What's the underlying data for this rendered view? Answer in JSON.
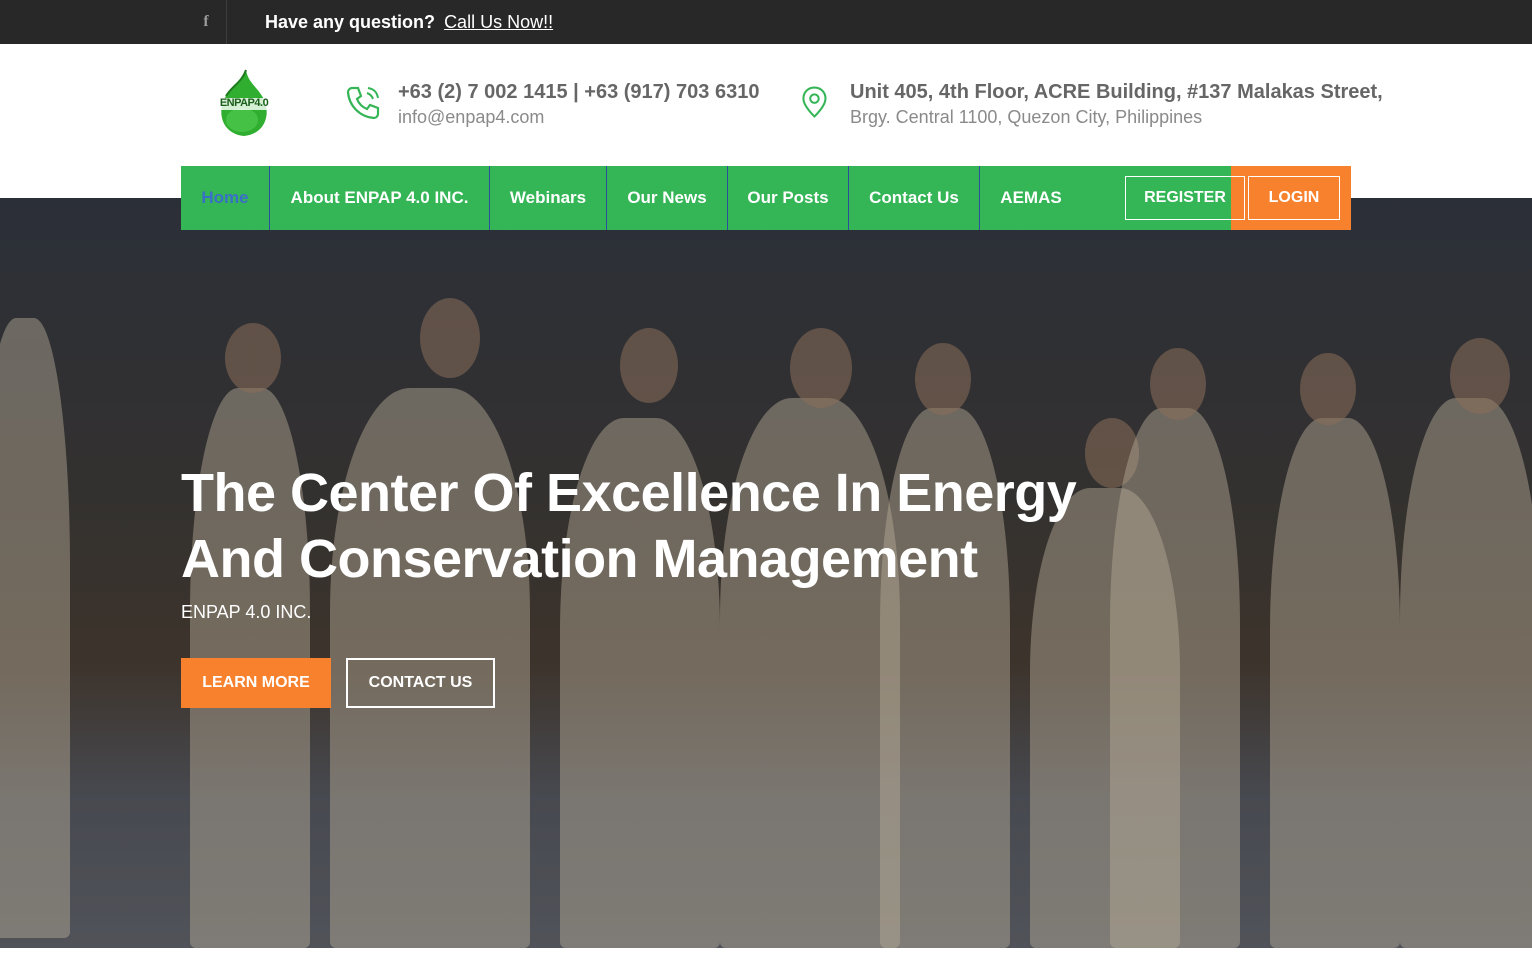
{
  "topbar": {
    "facebook_icon": "facebook-icon",
    "question": "Have any question?",
    "call_link": "Call Us Now!!"
  },
  "header": {
    "logo_text": "ENPAP4.0",
    "phone": "+63 (2) 7 002 1415 | +63 (917) 703 6310",
    "email": "info@enpap4.com",
    "address_line1": "Unit 405, 4th Floor, ACRE Building, #137 Malakas Street,",
    "address_line2": "Brgy. Central 1100, Quezon City, Philippines"
  },
  "nav": {
    "items": [
      {
        "label": "Home"
      },
      {
        "label": "About ENPAP 4.0 INC."
      },
      {
        "label": "Webinars"
      },
      {
        "label": "Our News"
      },
      {
        "label": "Our Posts"
      },
      {
        "label": "Contact Us"
      },
      {
        "label": "AEMAS"
      }
    ],
    "register": "REGISTER",
    "login": "LOGIN"
  },
  "hero": {
    "title_line1": "The Center Of Excellence In Energy",
    "title_line2": "And Conservation Management",
    "subtitle": "ENPAP 4.0 INC.",
    "learn_more": "LEARN MORE",
    "contact_us": "CONTACT US"
  },
  "colors": {
    "green": "#34b556",
    "orange": "#f7812d",
    "topbar": "#282828",
    "active_nav": "#3a6fc7"
  }
}
